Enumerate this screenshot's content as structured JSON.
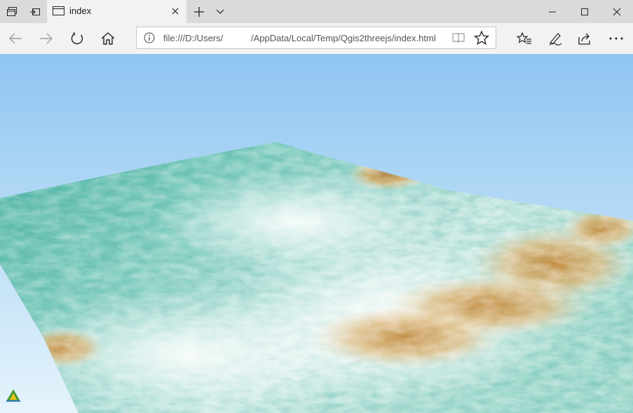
{
  "titlebar": {
    "tab_title": "index"
  },
  "navbar": {
    "address_url": "file:///D:/Users/           /AppData/Local/Temp/Qgis2threejs/index.html"
  },
  "colors": {
    "accent": "#0078d7",
    "sky_top": "#8ec5f1",
    "sky_bottom": "#e6f4fc",
    "terrain_low": "#3fae9c",
    "terrain_mid": "#d8eeea",
    "terrain_high": "#c8a055",
    "base_edge": "#bfa07e"
  },
  "icons": [
    "tab-manager-icon",
    "tab-aside-icon",
    "page-icon",
    "close-icon",
    "plus-icon",
    "chevron-down-icon",
    "minimize-icon",
    "maximize-icon",
    "back-arrow-icon",
    "forward-arrow-icon",
    "refresh-icon",
    "home-icon",
    "info-icon",
    "reading-view-icon",
    "star-icon",
    "favorites-list-icon",
    "pen-icon",
    "share-icon",
    "more-icon",
    "qgis2threejs-logo"
  ]
}
